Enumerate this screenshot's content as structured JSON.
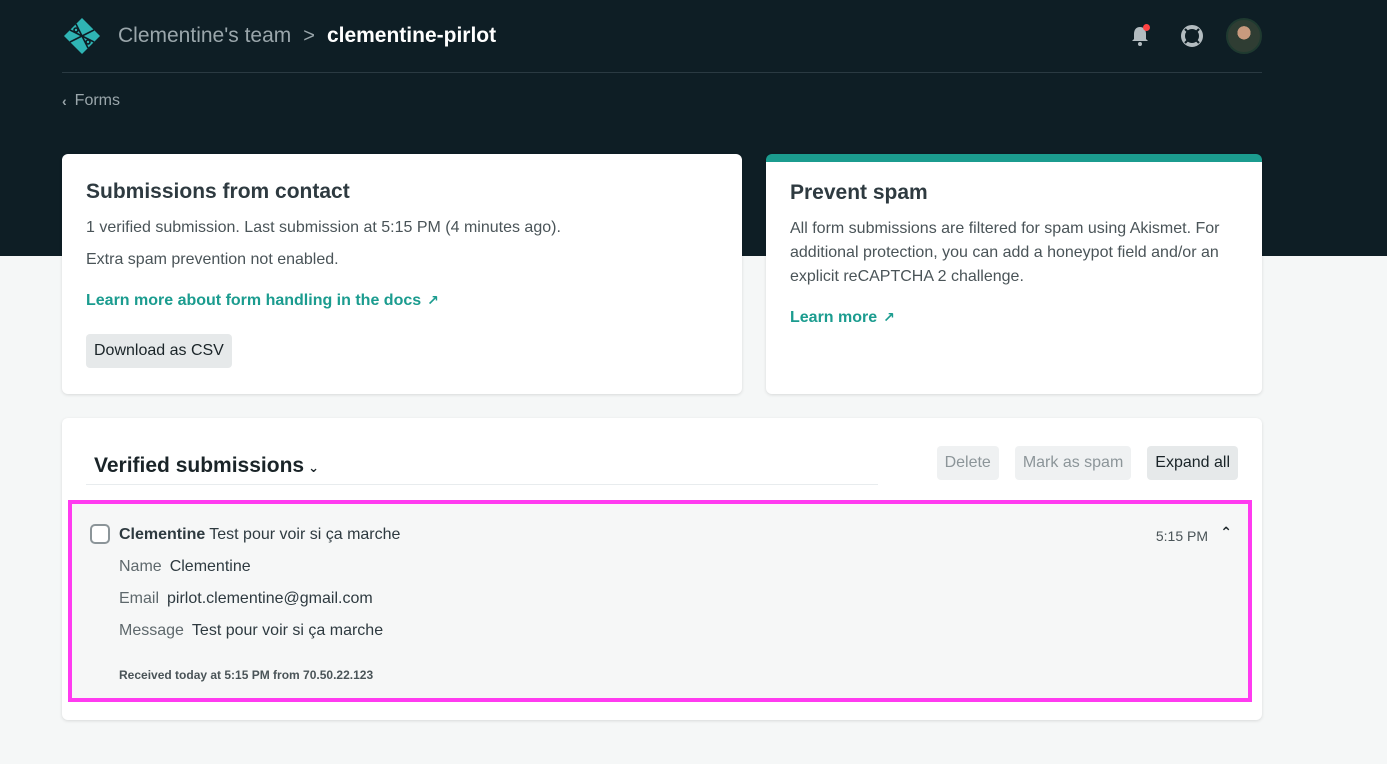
{
  "header": {
    "team": "Clementine's team",
    "separator": ">",
    "site": "clementine-pirlot"
  },
  "nav": {
    "back_label": "Forms"
  },
  "submissions_card": {
    "title": "Submissions from contact",
    "summary": "1 verified submission. Last submission at 5:15 PM (4 minutes ago).",
    "spam_status": "Extra spam prevention not enabled.",
    "docs_link": "Learn more about form handling in the docs",
    "download_label": "Download as CSV"
  },
  "spam_card": {
    "title": "Prevent spam",
    "body": "All form submissions are filtered for spam using Akismet. For additional protection, you can add a honeypot field and/or an explicit reCAPTCHA 2 challenge.",
    "link": "Learn more",
    "accent": "#1b9c8f"
  },
  "list": {
    "title": "Verified submissions",
    "actions": {
      "delete": "Delete",
      "mark_spam": "Mark as spam",
      "expand_all": "Expand all"
    },
    "submission": {
      "name": "Clementine",
      "preview": "Test pour voir si ça marche",
      "time": "5:15 PM",
      "fields": [
        {
          "key": "Name",
          "value": "Clementine"
        },
        {
          "key": "Email",
          "value": "pirlot.clementine@gmail.com"
        },
        {
          "key": "Message",
          "value": "Test pour voir si ça marche"
        }
      ],
      "received": "Received today at 5:15 PM from 70.50.22.123",
      "highlight_color": "#ff3bf0"
    }
  },
  "icons": [
    "netlify-logo-icon",
    "bell-icon",
    "support-icon",
    "avatar"
  ],
  "colors": {
    "header_bg": "#0e1e25",
    "accent": "#1b9c8f",
    "notification_dot": "#ff4343"
  }
}
